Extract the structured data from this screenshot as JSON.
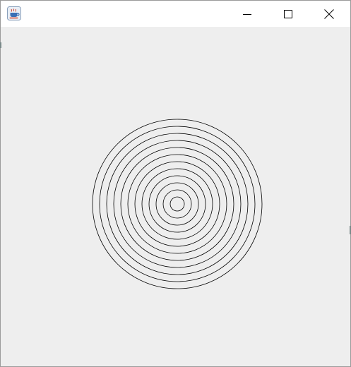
{
  "window": {
    "title": "",
    "app_icon": "java-coffee-cup-icon",
    "controls": [
      "minimize-icon",
      "maximize-icon",
      "close-icon"
    ]
  },
  "drawing": {
    "shape": "concentric circles",
    "ring_count": 12,
    "stroke_color": "#000000",
    "background_color": "#eeeeee"
  }
}
